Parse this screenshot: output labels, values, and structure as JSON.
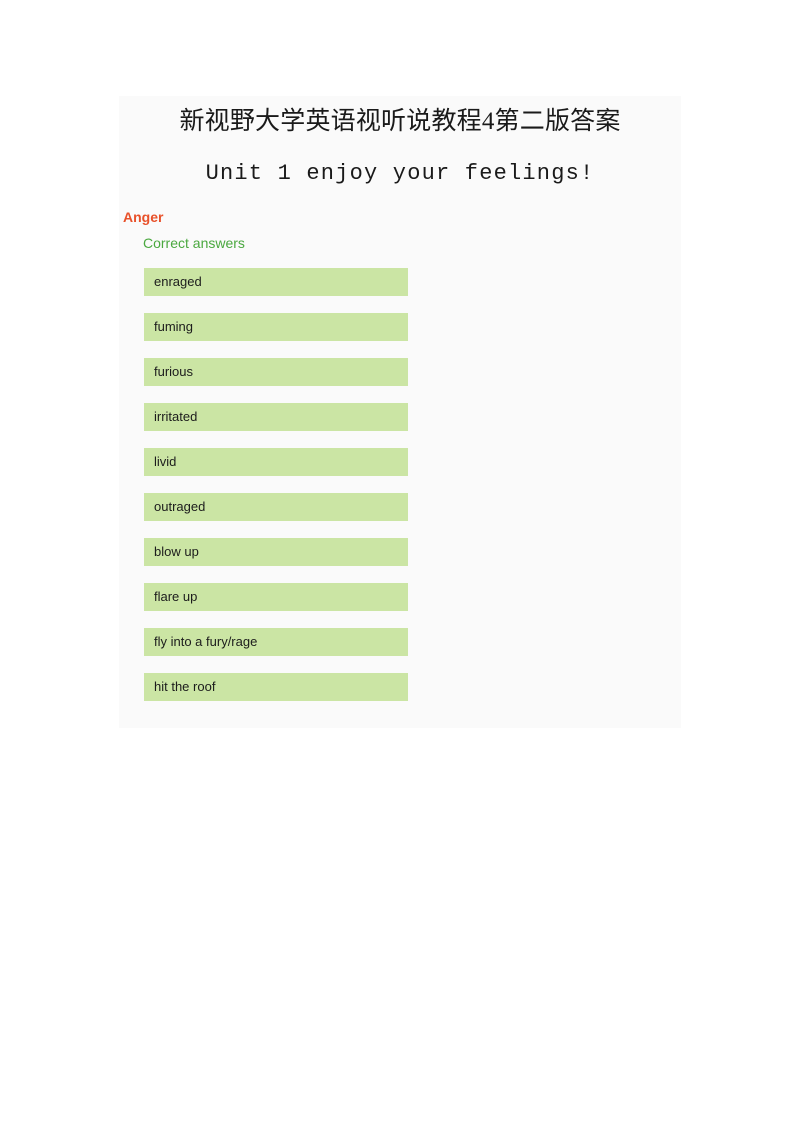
{
  "document": {
    "title": "新视野大学英语视听说教程4第二版答案",
    "subtitle": "Unit 1 enjoy your feelings!"
  },
  "quiz": {
    "category": "Anger",
    "correct_answers_label": "Correct answers",
    "answers": [
      "enraged",
      "fuming",
      "furious",
      "irritated",
      "livid",
      "outraged",
      "blow up",
      "flare up",
      "fly into a fury/rage",
      "hit the roof"
    ]
  },
  "colors": {
    "page_background": "#ffffff",
    "panel_background": "#fafafa",
    "answer_box": "#cbe5a4",
    "category_accent": "#e8512a",
    "correct_label": "#4aa83f",
    "body_text": "#1c1c1c"
  }
}
